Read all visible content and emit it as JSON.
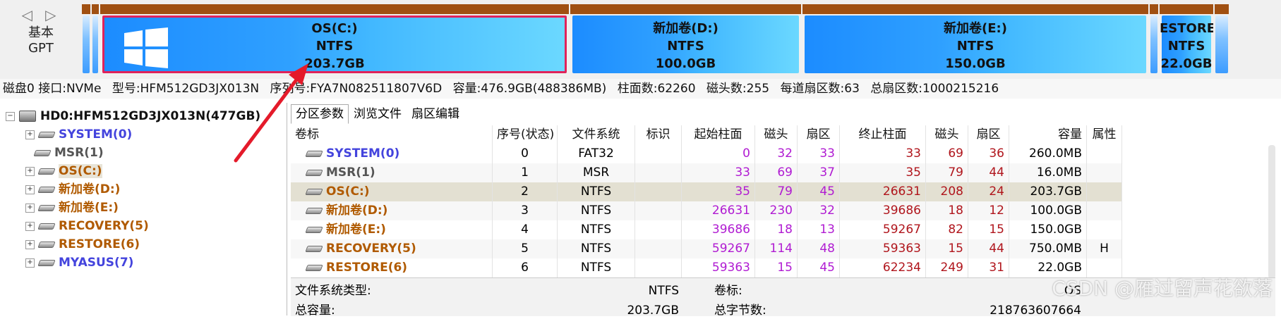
{
  "disk_label": {
    "nav": "◁ ▷",
    "kind": "基本",
    "scheme": "GPT"
  },
  "segments": [
    {
      "name": "OS(C:)",
      "fs": "NTFS",
      "size": "203.7GB"
    },
    {
      "name": "新加卷(D:)",
      "fs": "NTFS",
      "size": "100.0GB"
    },
    {
      "name": "新加卷(E:)",
      "fs": "NTFS",
      "size": "150.0GB"
    },
    {
      "name": "ESTORE(",
      "fs": "NTFS",
      "size": "22.0GB"
    }
  ],
  "infobar": {
    "disk": "磁盘0 接口:NVMe",
    "model": "型号:HFM512GD3JX013N",
    "serial": "序列号:FYA7N082511807V6D",
    "capacity": "容量:476.9GB(488386MB)",
    "cylinders": "柱面数:62260",
    "heads": "磁头数:255",
    "sectors_per_track": "每道扇区数:63",
    "total_sectors": "总扇区数:1000215216"
  },
  "tree": {
    "root": "HD0:HFM512GD3JX013N(477GB)",
    "items": [
      {
        "label": "SYSTEM(0)"
      },
      {
        "label": "MSR(1)"
      },
      {
        "label": "OS(C:)"
      },
      {
        "label": "新加卷(D:)"
      },
      {
        "label": "新加卷(E:)"
      },
      {
        "label": "RECOVERY(5)"
      },
      {
        "label": "RESTORE(6)"
      },
      {
        "label": "MYASUS(7)"
      }
    ]
  },
  "tabs": [
    "分区参数",
    "浏览文件",
    "扇区编辑"
  ],
  "columns": [
    "卷标",
    "序号(状态)",
    "文件系统",
    "标识",
    "起始柱面",
    "磁头",
    "扇区",
    "终止柱面",
    "磁头",
    "扇区",
    "容量",
    "属性"
  ],
  "rows": [
    [
      "SYSTEM(0)",
      "0",
      "FAT32",
      "",
      "0",
      "32",
      "33",
      "33",
      "69",
      "36",
      "260.0MB",
      ""
    ],
    [
      "MSR(1)",
      "1",
      "MSR",
      "",
      "33",
      "69",
      "37",
      "35",
      "79",
      "44",
      "16.0MB",
      ""
    ],
    [
      "OS(C:)",
      "2",
      "NTFS",
      "",
      "35",
      "79",
      "45",
      "26631",
      "208",
      "24",
      "203.7GB",
      ""
    ],
    [
      "新加卷(D:)",
      "3",
      "NTFS",
      "",
      "26631",
      "230",
      "32",
      "39686",
      "18",
      "12",
      "100.0GB",
      ""
    ],
    [
      "新加卷(E:)",
      "4",
      "NTFS",
      "",
      "39686",
      "18",
      "13",
      "59267",
      "82",
      "15",
      "150.0GB",
      ""
    ],
    [
      "RECOVERY(5)",
      "5",
      "NTFS",
      "",
      "59267",
      "114",
      "48",
      "59363",
      "15",
      "44",
      "750.0MB",
      "H"
    ],
    [
      "RESTORE(6)",
      "6",
      "NTFS",
      "",
      "59363",
      "15",
      "45",
      "62234",
      "249",
      "31",
      "22.0GB",
      ""
    ]
  ],
  "details": {
    "fs_type_label": "文件系统类型:",
    "fs_type_value": "NTFS",
    "volume_label": "卷标:",
    "volume_value": "OS",
    "total_label": "总容量:",
    "total_value": "203.7GB",
    "total_bytes_label": "总字节数:",
    "total_bytes_value": "218763607664"
  },
  "watermark": "CSDN @雁过留声花欲落",
  "colors": {
    "accent": "#e0225a",
    "segment_cap": "#a05012",
    "tree_blue": "#4444dd",
    "tree_brown": "#b05a00"
  }
}
